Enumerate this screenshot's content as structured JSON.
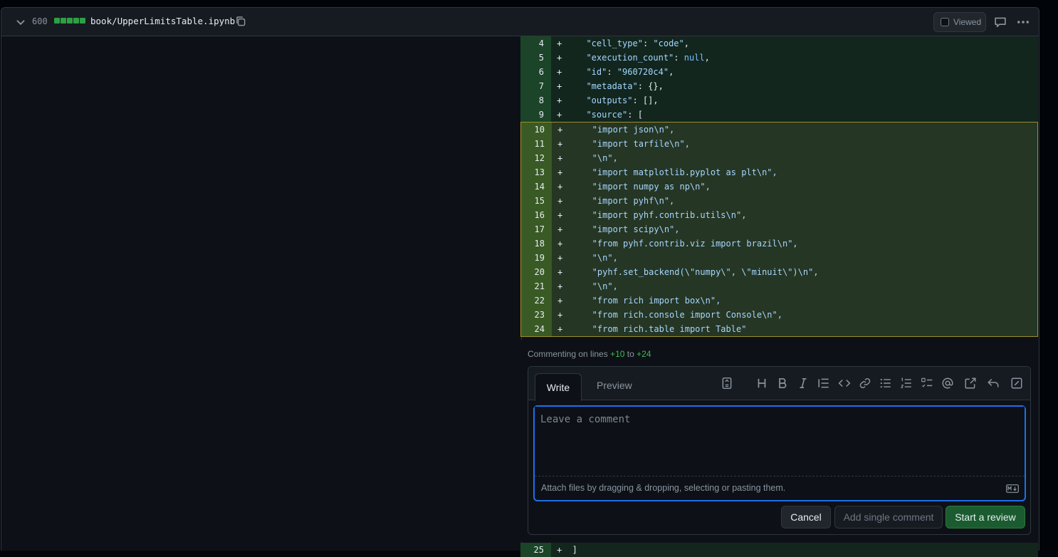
{
  "file": {
    "diffstat_count": "600",
    "filename": "book/UpperLimitsTable.ipynb",
    "viewed_label": "Viewed"
  },
  "lines": [
    {
      "num": "4",
      "sign": "+",
      "pre": "  ",
      "key": "\"cell_type\"",
      "rest": ": ",
      "val": "\"code\"",
      "tail": ","
    },
    {
      "num": "5",
      "sign": "+",
      "pre": "  ",
      "key": "\"execution_count\"",
      "rest": ": ",
      "val": "null",
      "tail": ","
    },
    {
      "num": "6",
      "sign": "+",
      "pre": "  ",
      "key": "\"id\"",
      "rest": ": ",
      "val": "\"960720c4\"",
      "tail": ","
    },
    {
      "num": "7",
      "sign": "+",
      "pre": "  ",
      "key": "\"metadata\"",
      "rest": ": {},",
      "val": "",
      "tail": ""
    },
    {
      "num": "8",
      "sign": "+",
      "pre": "  ",
      "key": "\"outputs\"",
      "rest": ": [],",
      "val": "",
      "tail": ""
    },
    {
      "num": "9",
      "sign": "+",
      "pre": "  ",
      "key": "\"source\"",
      "rest": ": [",
      "val": "",
      "tail": ""
    }
  ],
  "selected_lines": [
    {
      "num": "10",
      "text": "   \"import json\\n\","
    },
    {
      "num": "11",
      "text": "   \"import tarfile\\n\","
    },
    {
      "num": "12",
      "text": "   \"\\n\","
    },
    {
      "num": "13",
      "text": "   \"import matplotlib.pyplot as plt\\n\","
    },
    {
      "num": "14",
      "text": "   \"import numpy as np\\n\","
    },
    {
      "num": "15",
      "text": "   \"import pyhf\\n\","
    },
    {
      "num": "16",
      "text": "   \"import pyhf.contrib.utils\\n\","
    },
    {
      "num": "17",
      "text": "   \"import scipy\\n\","
    },
    {
      "num": "18",
      "text": "   \"from pyhf.contrib.viz import brazil\\n\","
    },
    {
      "num": "19",
      "text": "   \"\\n\","
    },
    {
      "num": "20",
      "text": "   \"pyhf.set_backend(\\\"numpy\\\", \\\"minuit\\\")\\n\","
    },
    {
      "num": "21",
      "text": "   \"\\n\","
    },
    {
      "num": "22",
      "text": "   \"from rich import box\\n\","
    },
    {
      "num": "23",
      "text": "   \"from rich.console import Console\\n\","
    },
    {
      "num": "24",
      "text": "   \"from rich.table import Table\""
    }
  ],
  "last_line": {
    "num": "25",
    "sign": "+",
    "text": "  ]"
  },
  "comment": {
    "commenting_prefix": "Commenting on lines",
    "from": "+10",
    "to_word": "to",
    "to": "+24",
    "tab_write": "Write",
    "tab_preview": "Preview",
    "placeholder": "Leave a comment",
    "attach_hint": "Attach files by dragging & dropping, selecting or pasting them.",
    "cancel": "Cancel",
    "add_single": "Add single comment",
    "start_review": "Start a review"
  },
  "colors": {
    "accent_blue": "#1f6feb",
    "addition_green": "#2ea043",
    "selection_border": "#9e8e2c"
  }
}
